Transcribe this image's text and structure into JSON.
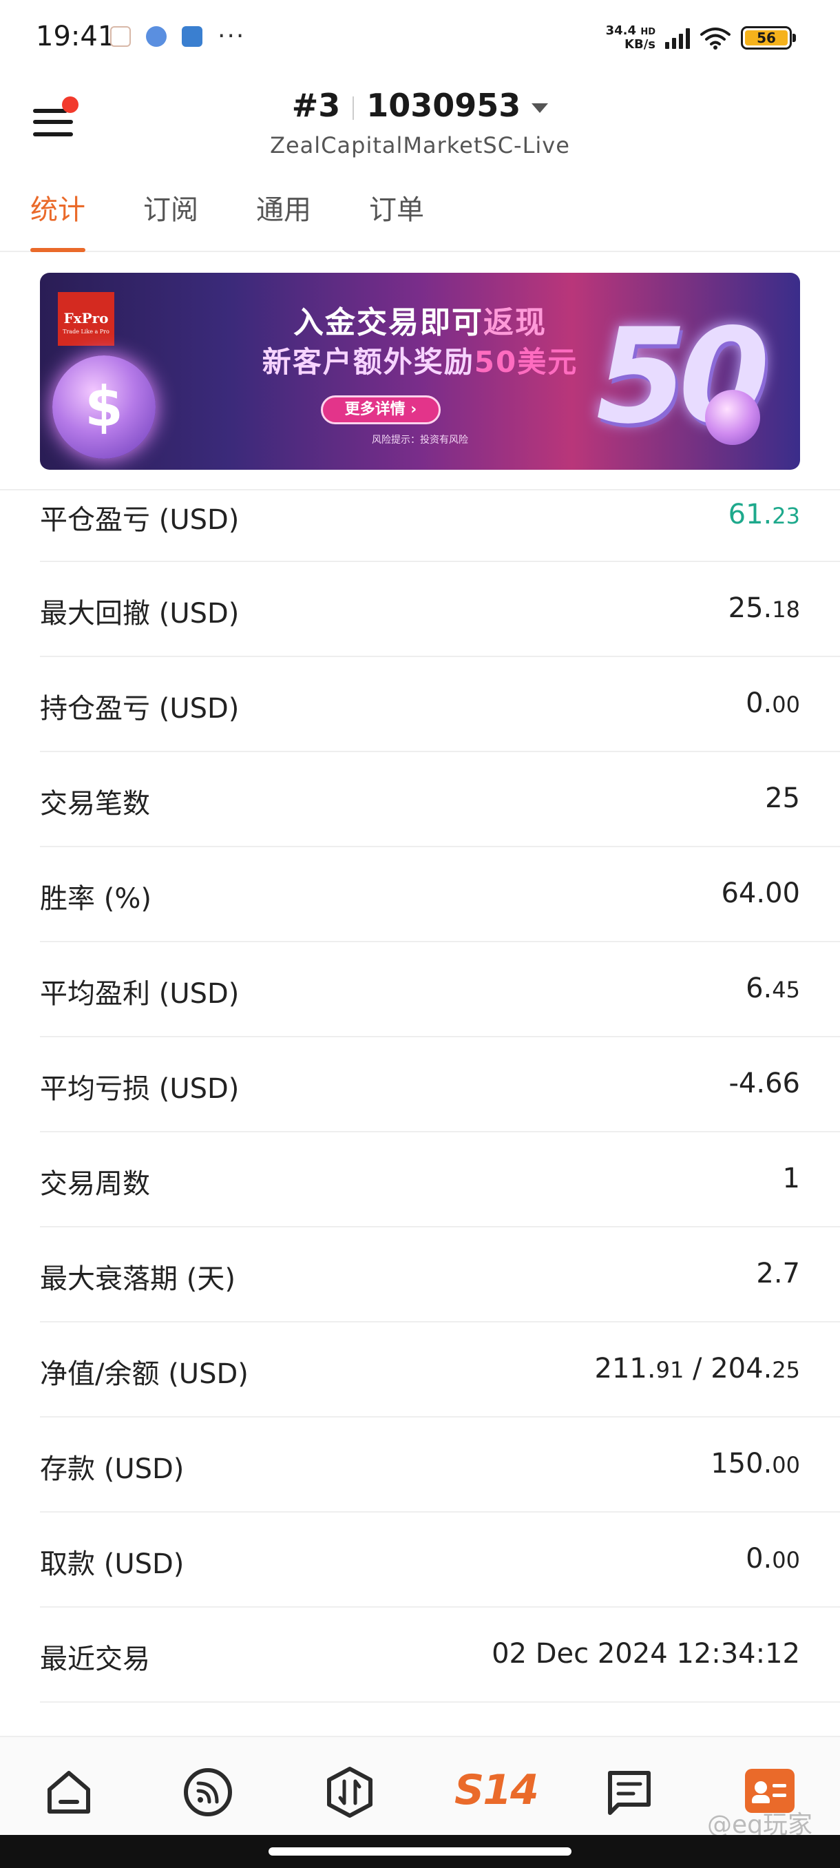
{
  "status_bar": {
    "time": "19:41",
    "net_speed_value": "34.4",
    "net_speed_unit": "KB/s",
    "network_type": "HD",
    "battery": "56"
  },
  "header": {
    "account_index": "#3",
    "account_number": "1030953",
    "server": "ZealCapitalMarketSC-Live"
  },
  "tabs": [
    {
      "label": "统计",
      "active": true
    },
    {
      "label": "订阅",
      "active": false
    },
    {
      "label": "通用",
      "active": false
    },
    {
      "label": "订单",
      "active": false
    }
  ],
  "banner": {
    "logo": "FxPro",
    "logo_tagline": "Trade Like a Pro",
    "line1_a": "入金交易即可",
    "line1_b": "返现",
    "line2_a": "新客户额外奖励",
    "line2_b": "50美元",
    "cta": "更多详情 ›",
    "risk_note": "风险提示：投资有风险",
    "big_number": "50"
  },
  "stats": [
    {
      "label": "平仓盈亏 (USD)",
      "int": "61.",
      "dec": "23",
      "color": "#1ea98c"
    },
    {
      "label": "最大回撤 (USD)",
      "int": "25.",
      "dec": "18"
    },
    {
      "label": "持仓盈亏 (USD)",
      "int": "0.",
      "dec": "00"
    },
    {
      "label": "交易笔数",
      "int": "25",
      "dec": ""
    },
    {
      "label": "胜率 (%)",
      "int": "64.00",
      "dec": ""
    },
    {
      "label": "平均盈利 (USD)",
      "int": "6.",
      "dec": "45"
    },
    {
      "label": "平均亏损 (USD)",
      "int": "-4.66",
      "dec": ""
    },
    {
      "label": "交易周数",
      "int": "1",
      "dec": ""
    },
    {
      "label": "最大衰落期 (天)",
      "int": "2.7",
      "dec": ""
    },
    {
      "label": "净值/余额 (USD)",
      "int": "211.",
      "dec": "91",
      "int2": " / 204.",
      "dec2": "25"
    },
    {
      "label": "存款 (USD)",
      "int": "150.",
      "dec": "00"
    },
    {
      "label": "取款 (USD)",
      "int": "0.",
      "dec": "00"
    },
    {
      "label": "最近交易",
      "int": "02 Dec 2024 12:34:12",
      "dec": ""
    }
  ],
  "bottom_nav": {
    "brand": "S14"
  },
  "watermark": "@eq玩家",
  "colors": {
    "accent": "#ea6a2a",
    "profit_green": "#1ea98c",
    "notification_dot": "#f23a2c"
  }
}
